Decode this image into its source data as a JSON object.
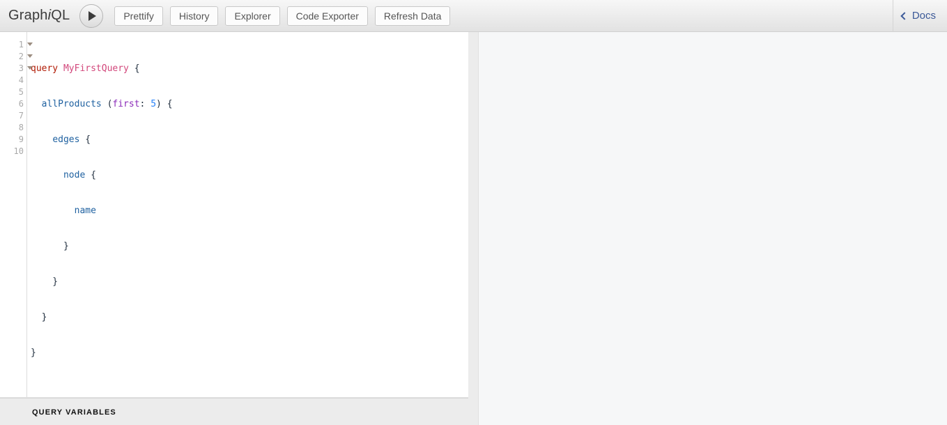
{
  "app": {
    "logo_prefix": "Graph",
    "logo_italic": "i",
    "logo_suffix": "QL"
  },
  "toolbar": {
    "execute_icon": "play-icon",
    "buttons": [
      {
        "label": "Prettify",
        "name": "prettify-button"
      },
      {
        "label": "History",
        "name": "history-button"
      },
      {
        "label": "Explorer",
        "name": "explorer-button"
      },
      {
        "label": "Code Exporter",
        "name": "code-exporter-button"
      },
      {
        "label": "Refresh Data",
        "name": "refresh-data-button"
      }
    ],
    "docs": {
      "label": "Docs",
      "icon": "chevron-left-icon",
      "color": "#3b5998"
    }
  },
  "editor": {
    "gutter": [
      {
        "number": "1",
        "fold": true
      },
      {
        "number": "2",
        "fold": true
      },
      {
        "number": "3",
        "fold": true
      },
      {
        "number": "4",
        "fold": false
      },
      {
        "number": "5",
        "fold": false
      },
      {
        "number": "6",
        "fold": false
      },
      {
        "number": "7",
        "fold": false
      },
      {
        "number": "8",
        "fold": false
      },
      {
        "number": "9",
        "fold": false
      },
      {
        "number": "10",
        "fold": false
      }
    ],
    "code_lines": [
      "query MyFirstQuery {",
      "  allProducts (first: 5) {",
      "    edges {",
      "      node {",
      "        name",
      "      }",
      "    }",
      "  }",
      "}",
      ""
    ],
    "tokens": {
      "keyword": "query",
      "operation_name": "MyFirstQuery",
      "field_root": "allProducts",
      "argument_name": "first",
      "argument_value": "5",
      "field_edges": "edges",
      "field_node": "node",
      "field_name": "name"
    },
    "colors": {
      "keyword": "#b11a04",
      "definition": "#d2477b",
      "field": "#1f61a0",
      "argument": "#8b2bb9",
      "number": "#2882f9",
      "punctuation": "#1f2d3d"
    }
  },
  "variables": {
    "title": "QUERY VARIABLES",
    "value": ""
  },
  "result": {
    "value": ""
  }
}
